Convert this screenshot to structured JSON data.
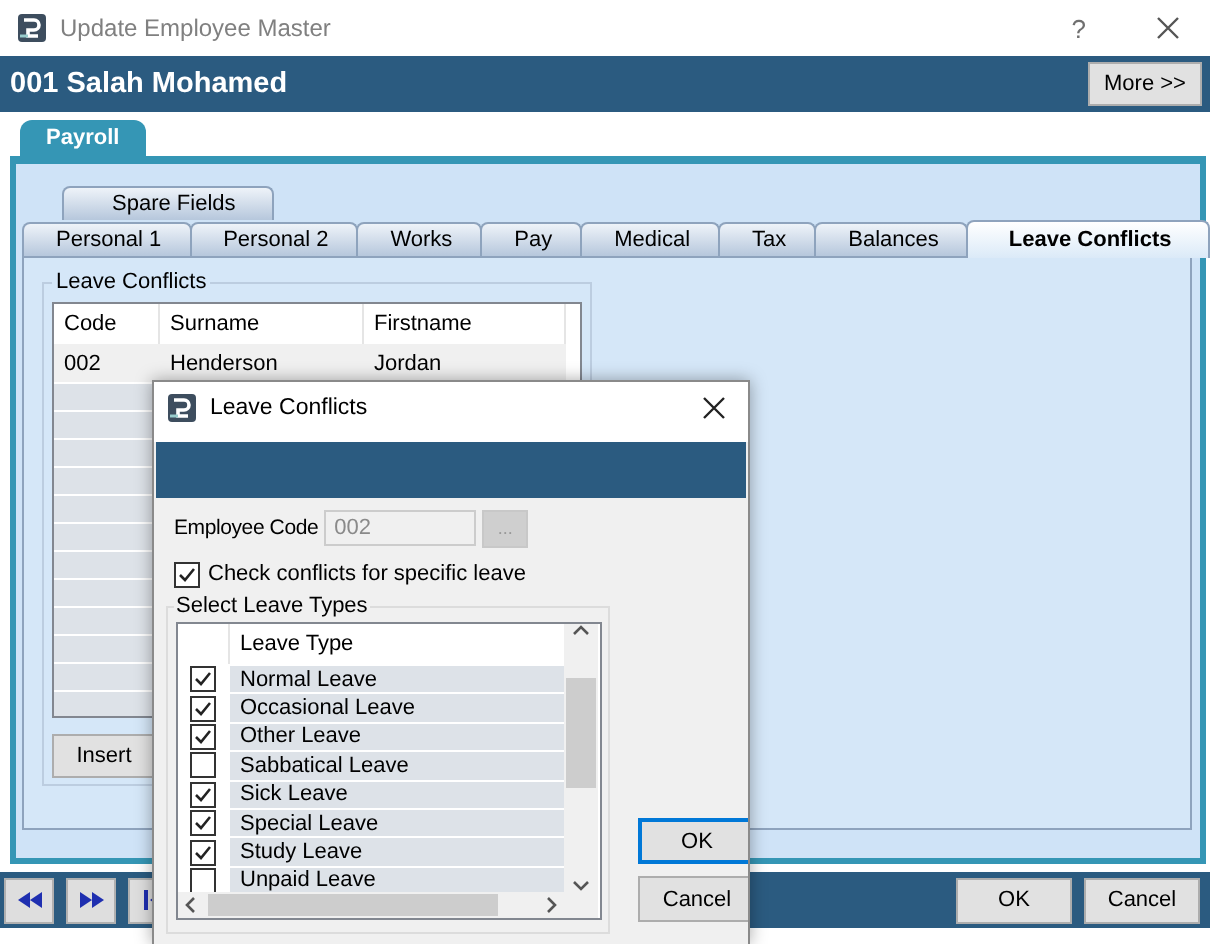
{
  "window": {
    "title": "Update Employee Master",
    "help": "?"
  },
  "header": {
    "title": "001 Salah Mohamed",
    "more_button": "More >>"
  },
  "module_tabs": [
    {
      "label": "Payroll",
      "selected": true
    }
  ],
  "tab_rows": [
    {
      "tabs": [
        {
          "label": "Spare Fields",
          "selected": false
        }
      ]
    },
    {
      "tabs": [
        {
          "label": "Personal 1",
          "selected": false
        },
        {
          "label": "Personal 2",
          "selected": false
        },
        {
          "label": "Works",
          "selected": false
        },
        {
          "label": "Pay",
          "selected": false
        },
        {
          "label": "Medical",
          "selected": false
        },
        {
          "label": "Tax",
          "selected": false
        },
        {
          "label": "Balances",
          "selected": false
        },
        {
          "label": "Leave Conflicts",
          "selected": true
        }
      ]
    }
  ],
  "leave_conflicts": {
    "title": "Leave Conflicts",
    "columns": [
      "Code",
      "Surname",
      "Firstname"
    ],
    "rows": [
      [
        "002",
        "Henderson",
        "Jordan"
      ]
    ],
    "buttons": [
      "Insert"
    ]
  },
  "footer": {
    "buttons": [
      "OK",
      "Cancel"
    ]
  },
  "dialog": {
    "title": "Leave Conflicts",
    "employee_code": {
      "label": "Employee Code",
      "value": "002",
      "disabled": true
    },
    "browse_button": {
      "label": "...",
      "disabled": true
    },
    "specific_leave": {
      "label": "Check conflicts for specific leave",
      "checked": true
    },
    "group_title": "Select Leave Types",
    "column": "Leave Type",
    "items": [
      {
        "label": "Normal Leave",
        "checked": true
      },
      {
        "label": "Occasional Leave",
        "checked": true
      },
      {
        "label": "Other Leave",
        "checked": true
      },
      {
        "label": "Sabbatical Leave",
        "checked": false
      },
      {
        "label": "Sick Leave",
        "checked": true
      },
      {
        "label": "Special Leave",
        "checked": true
      },
      {
        "label": "Study Leave",
        "checked": true
      },
      {
        "label": "Unpaid Leave",
        "checked": false
      }
    ],
    "buttons": [
      "OK",
      "Cancel"
    ]
  }
}
